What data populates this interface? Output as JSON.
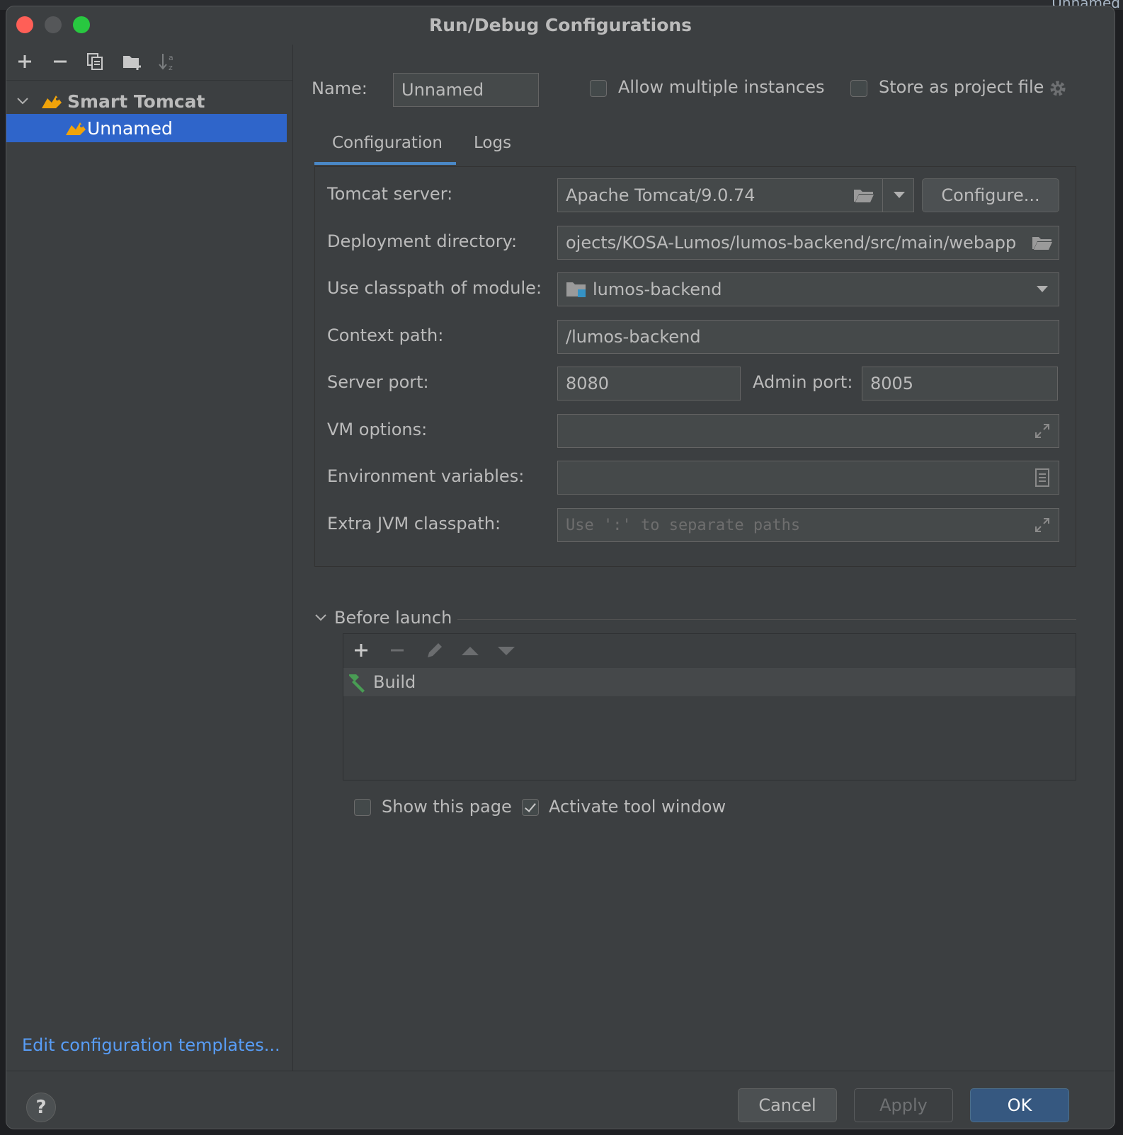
{
  "window": {
    "title": "Run/Debug Configurations"
  },
  "background_app": {
    "tab_fragment": "Unnamed"
  },
  "toolbar": {
    "icons": [
      "add-icon",
      "remove-icon",
      "copy-icon",
      "new-folder-icon",
      "sort-icon"
    ]
  },
  "tree": {
    "group_label": "Smart Tomcat",
    "selected_item": "Unnamed"
  },
  "edit_templates_link": "Edit configuration templates...",
  "form": {
    "name_label": "Name:",
    "name_value": "Unnamed",
    "allow_multiple_label": "Allow multiple instances",
    "allow_multiple_checked": false,
    "store_project_label": "Store as project file",
    "store_project_checked": false
  },
  "tabs": [
    {
      "label": "Configuration",
      "active": true
    },
    {
      "label": "Logs",
      "active": false
    }
  ],
  "config": {
    "tomcat_server_label": "Tomcat server:",
    "tomcat_server_value": "Apache Tomcat/9.0.74",
    "configure_button": "Configure...",
    "deployment_dir_label": "Deployment directory:",
    "deployment_dir_value": "ojects/KOSA-Lumos/lumos-backend/src/main/webapp",
    "classpath_module_label": "Use classpath of module:",
    "classpath_module_value": "lumos-backend",
    "context_path_label": "Context path:",
    "context_path_value": "/lumos-backend",
    "server_port_label": "Server port:",
    "server_port_value": "8080",
    "admin_port_label": "Admin port:",
    "admin_port_value": "8005",
    "vm_options_label": "VM options:",
    "vm_options_value": "",
    "env_vars_label": "Environment variables:",
    "env_vars_value": "",
    "extra_jvm_label": "Extra JVM classpath:",
    "extra_jvm_placeholder": "Use ':' to separate paths"
  },
  "before_launch": {
    "title": "Before launch",
    "items": [
      "Build"
    ],
    "show_page_label": "Show this page",
    "show_page_checked": false,
    "activate_tool_label": "Activate tool window",
    "activate_tool_checked": true
  },
  "buttons": {
    "cancel": "Cancel",
    "apply": "Apply",
    "ok": "OK",
    "help": "?"
  },
  "colors": {
    "accent": "#2f65ca",
    "link": "#589df6",
    "ok_button": "#365880"
  }
}
